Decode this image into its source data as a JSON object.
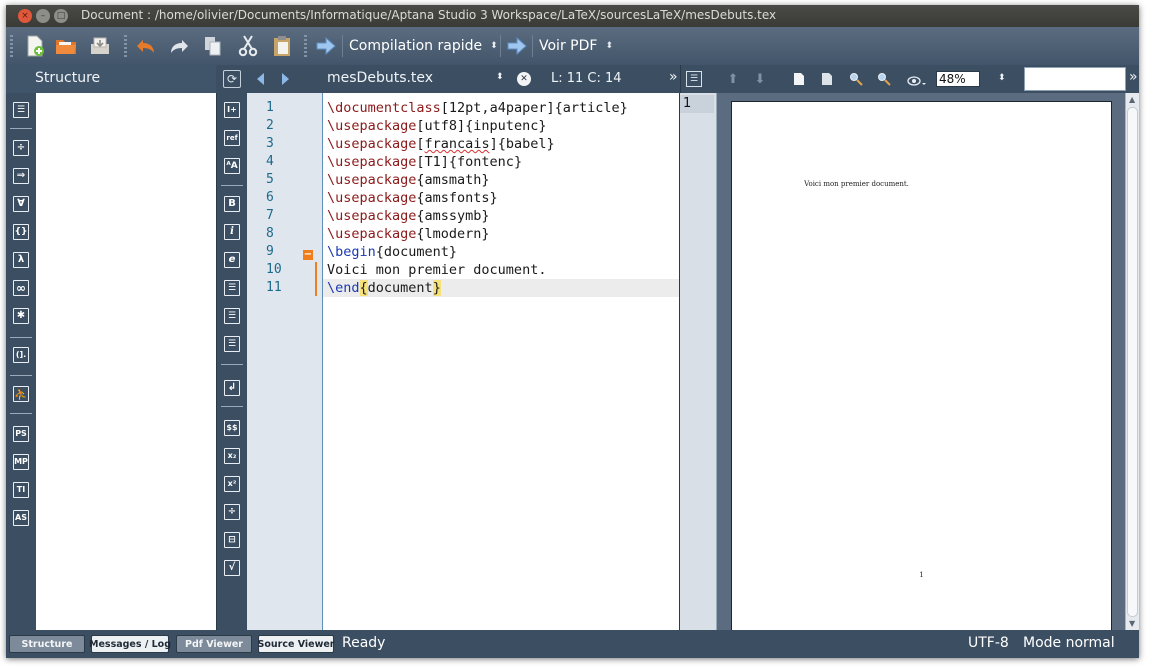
{
  "window": {
    "title": "Document : /home/olivier/Documents/Informatique/Aptana Studio 3 Workspace/LaTeX/sourcesLaTeX/mesDebuts.tex",
    "controls": {
      "close_glyph": "×",
      "minimize_glyph": "–",
      "maximize_glyph": "□"
    }
  },
  "toolbar": {
    "icons": [
      "new-file-icon",
      "open-folder-icon",
      "save-icon",
      "undo-icon",
      "redo-icon",
      "copy-icon",
      "cut-icon",
      "paste-icon",
      "run-arrow-icon",
      "view-arrow-icon"
    ],
    "compile_combo": "Compilation rapide",
    "view_combo": "Voir PDF",
    "combo_arrow": "⬍"
  },
  "structure_panel": {
    "title": "Structure"
  },
  "editor": {
    "tab_name": "mesDebuts.tex",
    "cursor_position": "L: 11 C: 14",
    "close_glyph": "✕",
    "more_glyph": "»",
    "lines": [
      {
        "num": "1",
        "cmd": "\\documentclass",
        "rest": "[12pt,a4paper]{article}"
      },
      {
        "num": "2",
        "cmd": "\\usepackage",
        "rest": "[utf8]{inputenc}"
      },
      {
        "num": "3",
        "cmd": "\\usepackage",
        "rest_pre": "[",
        "squiggle": "francais",
        "rest_post": "]{babel}"
      },
      {
        "num": "4",
        "cmd": "\\usepackage",
        "rest": "[T1]{fontenc}"
      },
      {
        "num": "5",
        "cmd": "\\usepackage",
        "rest": "{amsmath}"
      },
      {
        "num": "6",
        "cmd": "\\usepackage",
        "rest": "{amsfonts}"
      },
      {
        "num": "7",
        "cmd": "\\usepackage",
        "rest": "{amssymb}"
      },
      {
        "num": "8",
        "cmd": "\\usepackage",
        "rest": "{lmodern}"
      },
      {
        "num": "9",
        "cmd": "\\begin",
        "rest": "{document}"
      },
      {
        "num": "10",
        "text": "Voici mon premier document."
      },
      {
        "num": "11",
        "cmd": "\\end",
        "brace_open": "{",
        "rest": "document",
        "brace_close": "}"
      }
    ],
    "fold_marker": "−"
  },
  "pdf_viewer": {
    "page_field": "1",
    "zoom": "48%",
    "search_value": "",
    "more_glyph": "»",
    "page_body_text": "Voici mon premier document.",
    "page_footer_number": "1"
  },
  "left_palette": [
    "structure-icon",
    "divide-icon",
    "implies-icon",
    "forall-icon",
    "braces-icon",
    "lambda-icon",
    "infinity-icon",
    "asterisk-icon",
    "bracket-dot-icon",
    "stick-figure-icon",
    "ps-icon",
    "mp-icon",
    "ti-icon",
    "as-icon"
  ],
  "left_palette_labels": {
    "divide": "÷",
    "implies": "⇒",
    "forall": "∀",
    "braces": "{}",
    "lambda": "λ",
    "infinity": "∞",
    "asterisk": "✱",
    "bracket": "(].",
    "ps": "PS",
    "mp": "MP",
    "ti": "TI",
    "as": "AS"
  },
  "edit_palette_labels": {
    "insert": "I+",
    "ref": "ref",
    "size": "ᴬA",
    "bold": "B",
    "italic": "i",
    "emph": "e",
    "dollars": "$$",
    "sqrt": "√"
  },
  "status": {
    "tabs": [
      {
        "label": "Structure",
        "active": true
      },
      {
        "label": "Messages / Log",
        "active": false
      },
      {
        "label": "Pdf Viewer",
        "active": true
      },
      {
        "label": "Source Viewer",
        "active": false
      }
    ],
    "state": "Ready",
    "encoding": "UTF-8",
    "mode": "Mode normal"
  }
}
